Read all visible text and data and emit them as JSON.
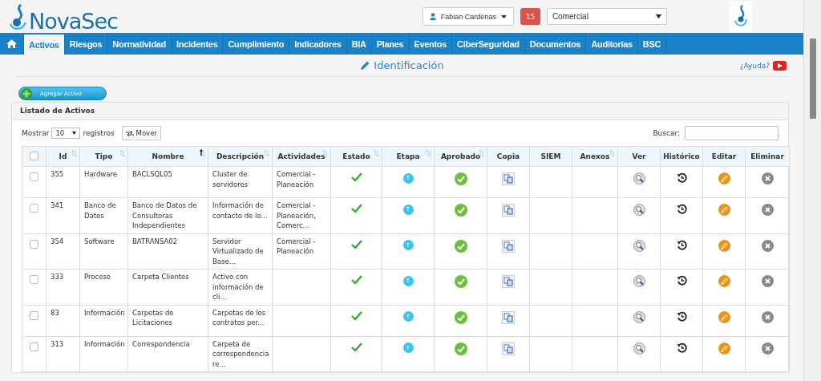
{
  "header": {
    "logo": "NovaSec",
    "user": "Fabian Cardenas",
    "notifications": "15",
    "area_select": "Comercial"
  },
  "nav": [
    {
      "kind": "home",
      "selected": false
    },
    {
      "kind": "tab",
      "label": "Activos",
      "selected": true
    },
    {
      "kind": "tab",
      "label": "Riesgos",
      "selected": false
    },
    {
      "kind": "tab",
      "label": "Normatividad",
      "selected": false
    },
    {
      "kind": "tab",
      "label": "Incidentes",
      "selected": false
    },
    {
      "kind": "tab",
      "label": "Cumplimiento",
      "selected": false
    },
    {
      "kind": "tab",
      "label": "Indicadores",
      "selected": false
    },
    {
      "kind": "tab",
      "label": "BIA",
      "selected": false
    },
    {
      "kind": "tab",
      "label": "Planes",
      "selected": false
    },
    {
      "kind": "tab",
      "label": "Eventos",
      "selected": false
    },
    {
      "kind": "tab",
      "label": "CiberSeguridad",
      "selected": false
    },
    {
      "kind": "tab",
      "label": "Documentos",
      "selected": false
    },
    {
      "kind": "tab",
      "label": "Auditorías",
      "selected": false
    },
    {
      "kind": "tab",
      "label": "BSC",
      "selected": false
    }
  ],
  "page_title": "Identificación",
  "help_link": "¿Ayuda?",
  "add_button": "Agregar Activo",
  "panel": {
    "title": "Listado de Activos",
    "show_label": "Mostrar",
    "page_size": "10",
    "records_label": "registros",
    "move_button": "Mover",
    "search_label": "Buscar:"
  },
  "table": {
    "select_all_checked": false,
    "columns": [
      {
        "kind": "check",
        "sortable": false,
        "sorted": false
      },
      {
        "kind": "text",
        "label": "Id",
        "sortable": true,
        "sorted": false
      },
      {
        "kind": "text",
        "label": "Tipo",
        "sortable": true,
        "sorted": false
      },
      {
        "kind": "text",
        "label": "Nombre",
        "sortable": true,
        "sorted": true
      },
      {
        "kind": "text",
        "label": "Descripción",
        "sortable": true,
        "sorted": false
      },
      {
        "kind": "text",
        "label": "Actividades",
        "sortable": true,
        "sorted": false
      },
      {
        "kind": "text",
        "label": "Estado",
        "sortable": true,
        "sorted": false
      },
      {
        "kind": "text",
        "label": "Etapa",
        "sortable": true,
        "sorted": false
      },
      {
        "kind": "text",
        "label": "Aprobado",
        "sortable": true,
        "sorted": false
      },
      {
        "kind": "text",
        "label": "Copia",
        "sortable": false,
        "sorted": false
      },
      {
        "kind": "text",
        "label": "SIEM",
        "sortable": false,
        "sorted": false
      },
      {
        "kind": "text",
        "label": "Anexos",
        "sortable": true,
        "sorted": false
      },
      {
        "kind": "text",
        "label": "Ver",
        "sortable": false,
        "sorted": false
      },
      {
        "kind": "text",
        "label": "Histórico",
        "sortable": false,
        "sorted": false
      },
      {
        "kind": "text",
        "label": "Editar",
        "sortable": false,
        "sorted": false
      },
      {
        "kind": "text",
        "label": "Eliminar",
        "sortable": false,
        "sorted": false
      }
    ],
    "rows": [
      {
        "checked": false,
        "id": "355",
        "tipo": "Hardware",
        "nombre": "BACLSQL05",
        "descripcion": "Cluster de servidores",
        "actividades": "Comercial - Planeación",
        "estado_ok": true,
        "etapa": "T",
        "aprobado": true
      },
      {
        "checked": false,
        "id": "341",
        "tipo": "Banco de Datos",
        "nombre": "Banco de Datos de Consultoras Independientes",
        "descripcion": "Información de contacto de lo...",
        "actividades": "Comercial - Planeación, Comerc...",
        "estado_ok": true,
        "etapa": "T",
        "aprobado": true
      },
      {
        "checked": false,
        "id": "354",
        "tipo": "Software",
        "nombre": "BATRANSA02",
        "descripcion": "Servidor Virtualizado de Base...",
        "actividades": "Comercial - Planeación",
        "estado_ok": true,
        "etapa": "T",
        "aprobado": true
      },
      {
        "checked": false,
        "id": "333",
        "tipo": "Proceso",
        "nombre": "Carpeta Clientes",
        "descripcion": "Activo con información de cli...",
        "estado_ok": true,
        "etapa": "T",
        "aprobado": true
      },
      {
        "checked": false,
        "id": "83",
        "tipo": "Información",
        "nombre": "Carpetas de Licitaciones",
        "descripcion": "Carpetas de los contratos per...",
        "estado_ok": true,
        "etapa": "T",
        "aprobado": true
      },
      {
        "checked": false,
        "id": "313",
        "tipo": "Información",
        "nombre": "Correspondencia",
        "descripcion": "Carpeta de correspondencia re...",
        "estado_ok": true,
        "etapa": "T",
        "aprobado": true
      }
    ]
  }
}
